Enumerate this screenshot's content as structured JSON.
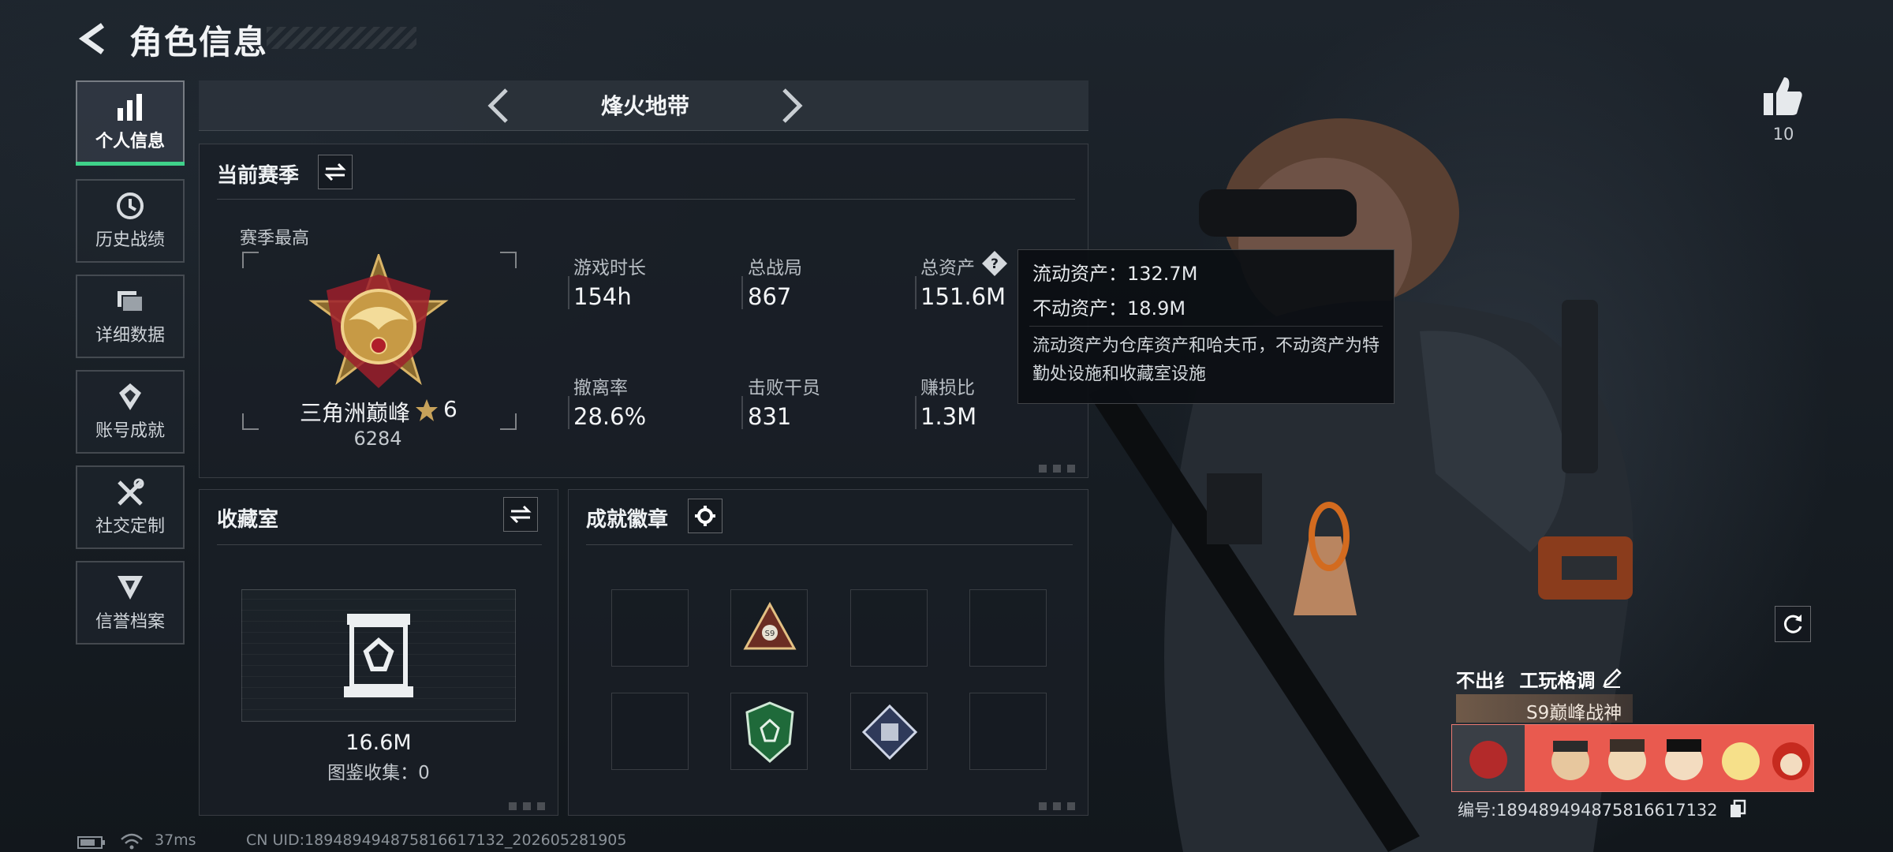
{
  "header": {
    "title": "角色信息"
  },
  "sidebar": {
    "items": [
      {
        "label": "个人信息",
        "icon": "bar-chart-icon",
        "active": true
      },
      {
        "label": "历史战绩",
        "icon": "history-clock-icon",
        "active": false
      },
      {
        "label": "详细数据",
        "icon": "folder-icon",
        "active": false
      },
      {
        "label": "账号成就",
        "icon": "achievement-icon",
        "active": false
      },
      {
        "label": "社交定制",
        "icon": "tools-icon",
        "active": false
      },
      {
        "label": "信誉档案",
        "icon": "credit-icon",
        "active": false
      }
    ]
  },
  "map_selector": {
    "name": "烽火地带"
  },
  "season": {
    "title": "当前赛季",
    "best_label": "赛季最高",
    "rank_name": "三角洲巅峰",
    "rank_stars": "6",
    "rank_score": "6284",
    "stats": [
      {
        "label": "游戏时长",
        "value": "154h"
      },
      {
        "label": "总战局",
        "value": "867"
      },
      {
        "label": "总资产",
        "value": "151.6M"
      },
      {
        "label": "撤离率",
        "value": "28.6%"
      },
      {
        "label": "击败干员",
        "value": "831"
      },
      {
        "label": "赚损比",
        "value": "1.3M"
      }
    ]
  },
  "tooltip": {
    "liquid": "流动资产：132.7M",
    "fixed": "不动资产：18.9M",
    "note": "流动资产为仓库资产和哈夫币，不动资产为特勤处设施和收藏室设施"
  },
  "collection": {
    "title": "收藏室",
    "value": "16.6M",
    "catalog": "图鉴收集：0"
  },
  "badges": {
    "title": "成就徽章",
    "slots": [
      "empty",
      "s9-badge",
      "empty",
      "empty",
      "empty",
      "green-shield-badge",
      "diamond-badge",
      "empty"
    ]
  },
  "profile": {
    "likes": "10",
    "name": "不出纟 工玩格调",
    "title_banner": "S9巅峰战神",
    "id": "编号:18948949487581661713​2"
  },
  "footer": {
    "ping": "37ms",
    "uid": "CN UID:18948949487581661713​2_202605281905"
  },
  "colors": {
    "accent": "#3fd28a",
    "panel": "#1a1f26",
    "tooltip_bg": "#0c0f13"
  }
}
